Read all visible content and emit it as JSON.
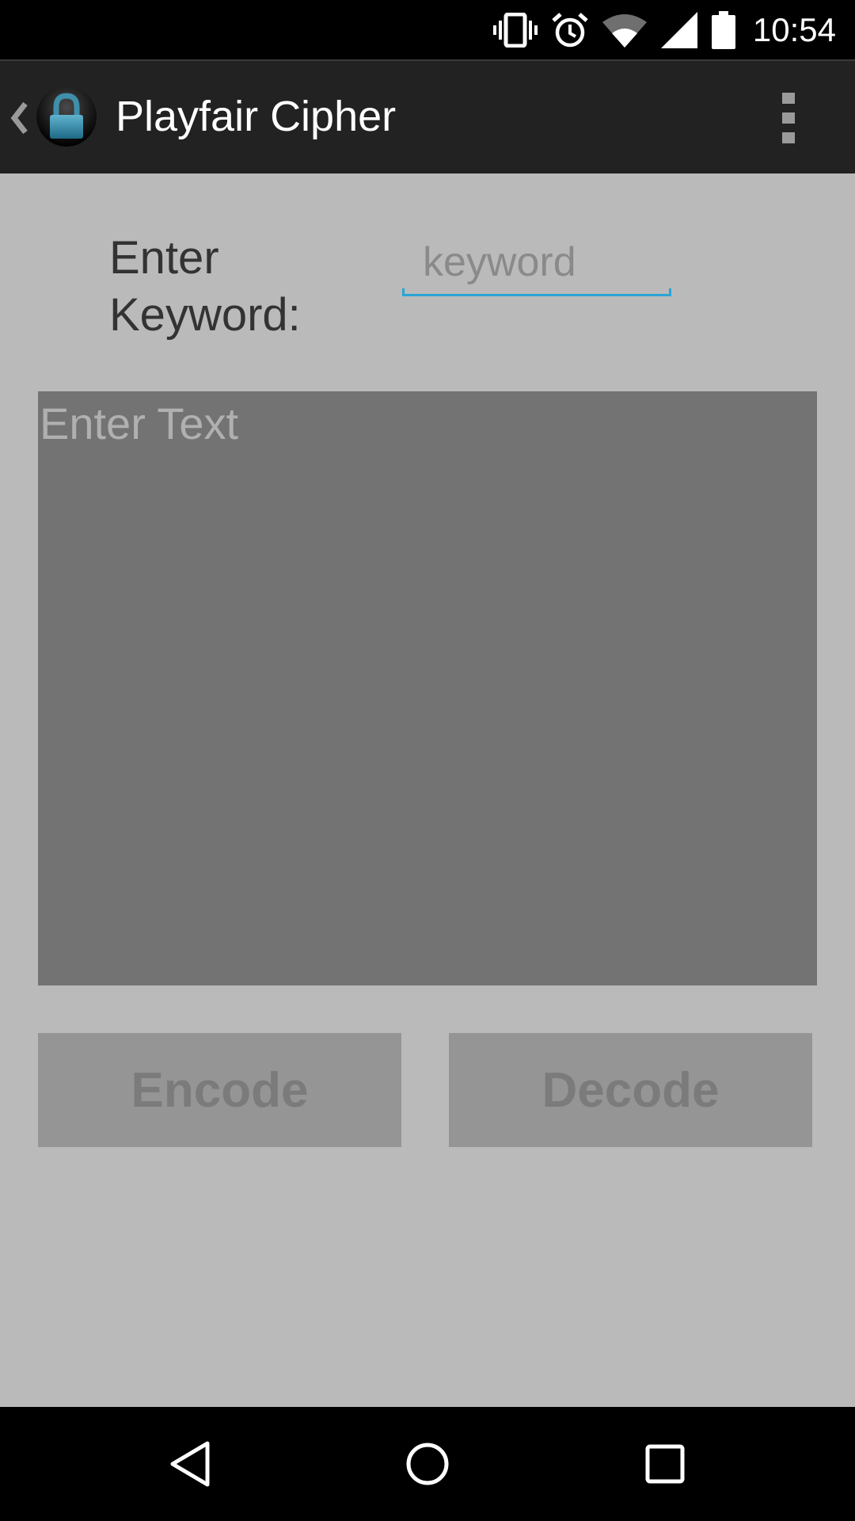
{
  "status_bar": {
    "time": "10:54",
    "icons": [
      "vibrate-icon",
      "alarm-icon",
      "wifi-icon",
      "signal-icon",
      "battery-icon"
    ]
  },
  "action_bar": {
    "title": "Playfair Cipher",
    "logo_icon": "padlock-icon",
    "menu_icon": "overflow-menu-icon"
  },
  "keyword": {
    "label": "Enter Keyword:",
    "placeholder": "keyword",
    "value": "",
    "accent_color": "#2aa4d5"
  },
  "text_input": {
    "placeholder": "Enter Text",
    "value": ""
  },
  "buttons": {
    "encode_label": "Encode",
    "decode_label": "Decode"
  },
  "nav_bar": {
    "icons": [
      "back-icon",
      "home-icon",
      "recents-icon"
    ]
  },
  "colors": {
    "background": "#bababa",
    "action_bar": "#222222",
    "text_area": "#737373",
    "button": "#959595"
  }
}
